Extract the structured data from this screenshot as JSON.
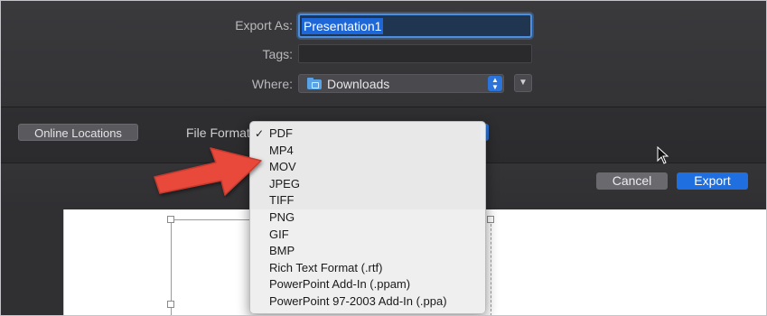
{
  "dialog": {
    "export_as_label": "Export As:",
    "export_as_value": "Presentation1",
    "tags_label": "Tags:",
    "tags_value": "",
    "where_label": "Where:",
    "where_value": "Downloads",
    "where_icon": "folder-icon",
    "online_locations_label": "Online Locations",
    "file_format_label": "File Format",
    "cancel_label": "Cancel",
    "export_label": "Export"
  },
  "format_menu": {
    "selected": "PDF",
    "items": [
      "PDF",
      "MP4",
      "MOV",
      "JPEG",
      "TIFF",
      "PNG",
      "GIF",
      "BMP",
      "Rich Text Format (.rtf)",
      "PowerPoint Add-In (.ppam)",
      "PowerPoint 97-2003 Add-In (.ppa)"
    ]
  },
  "annotation": {
    "arrow_color": "#e8483a",
    "points_to": "MOV"
  },
  "colors": {
    "accent": "#1f6fe0",
    "sheet_bg": "#333336"
  }
}
